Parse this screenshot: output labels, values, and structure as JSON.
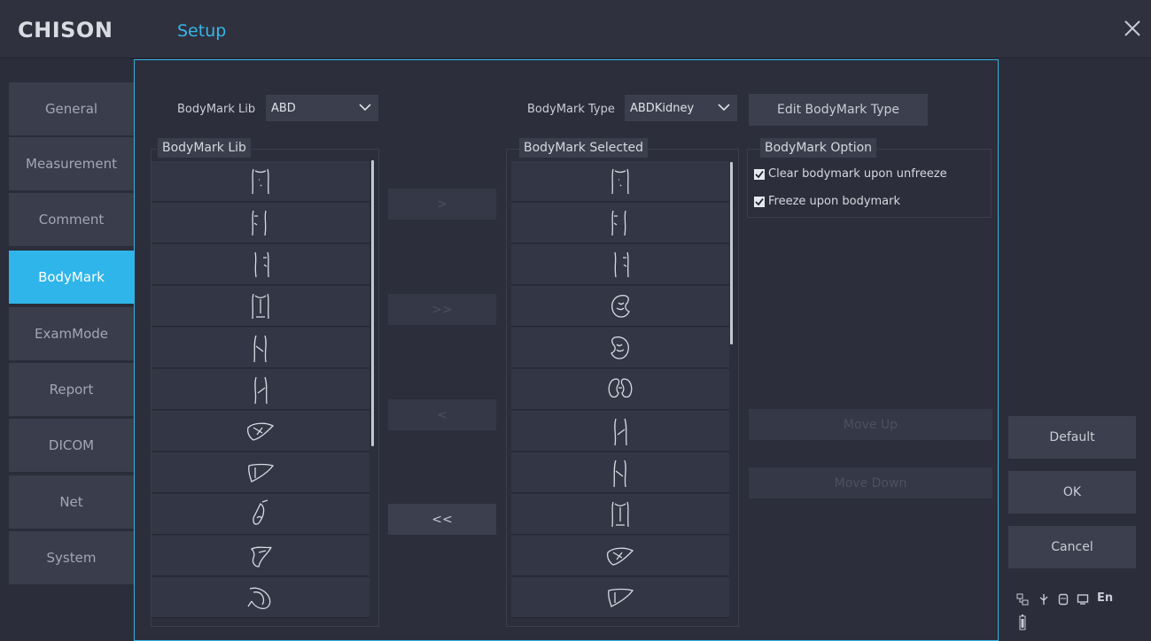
{
  "header": {
    "logo": "CHISON",
    "title": "Setup"
  },
  "sidebar": {
    "items": [
      {
        "label": "General"
      },
      {
        "label": "Measurement"
      },
      {
        "label": "Comment"
      },
      {
        "label": "BodyMark",
        "active": true
      },
      {
        "label": "ExamMode"
      },
      {
        "label": "Report"
      },
      {
        "label": "DICOM"
      },
      {
        "label": "Net"
      },
      {
        "label": "System"
      }
    ]
  },
  "bodymark": {
    "lib_label": "BodyMark Lib",
    "lib_value": "ABD",
    "type_label": "BodyMark Type",
    "type_value": "ABDKidney",
    "edit_type_button": "Edit BodyMark Type",
    "lib_list_title": "BodyMark Lib",
    "selected_list_title": "BodyMark Selected",
    "option_title": "BodyMark Option",
    "options": [
      {
        "label": "Clear bodymark upon unfreeze",
        "checked": true
      },
      {
        "label": "Freeze upon bodymark",
        "checked": true
      }
    ],
    "transfer_buttons": {
      "add": ">",
      "add_all": ">>",
      "remove": "<",
      "remove_all": "<<"
    },
    "move_up": "Move Up",
    "move_down": "Move Down",
    "lib_items": [
      "torso-front-icon",
      "torso-left-icon",
      "torso-right-icon",
      "torso-back-icon",
      "flank-left-icon",
      "flank-right-icon",
      "liver-icon",
      "liver-outline-icon",
      "gallbladder-icon",
      "pancreas-icon",
      "stomach-icon"
    ],
    "selected_items": [
      "torso-front-icon",
      "torso-left-icon",
      "torso-right-icon",
      "kidney-left-icon",
      "kidney-right-icon",
      "kidneys-pair-icon",
      "flank-right-icon",
      "flank-left-icon",
      "torso-back-icon",
      "liver-icon",
      "liver-outline-icon"
    ]
  },
  "actions": {
    "default": "Default",
    "ok": "OK",
    "cancel": "Cancel"
  },
  "status": {
    "language": "En"
  },
  "colors": {
    "accent": "#2fb5e9",
    "background": "#2b2d3a"
  }
}
